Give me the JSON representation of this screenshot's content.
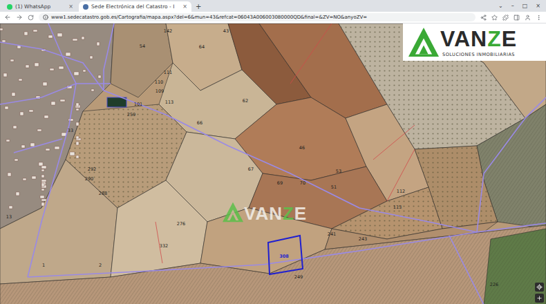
{
  "browser": {
    "tabs": [
      {
        "label": "(1) WhatsApp",
        "selected": false,
        "close": "×",
        "favicon_color": "#25d366"
      },
      {
        "label": "Sede Electrónica del Catastro - I",
        "selected": true,
        "close": "×",
        "favicon_color": "#4a6fa5"
      }
    ],
    "new_tab": "+",
    "window_controls": [
      "⌄",
      "–",
      "□",
      "×"
    ],
    "address": "www1.sedecatastro.gob.es/Cartografia/mapa.aspx?del=6&mun=43&refcat=06043A006003080000QD&final=&ZV=NO&anyoZV="
  },
  "logo": {
    "letters": [
      {
        "text": "VAN",
        "color": "#2b2b2b"
      },
      {
        "text": "Z",
        "color": "#3aa935"
      },
      {
        "text": "E",
        "color": "#2b2b2b"
      }
    ],
    "tagline": "SOLUCIONES INMOBILIARIAS"
  },
  "watermark": {
    "letters": [
      {
        "text": "VAN",
        "color": "#f2efe9"
      },
      {
        "text": "Z",
        "color": "#5cc04a"
      },
      {
        "text": "E",
        "color": "#f2efe9"
      }
    ]
  },
  "parcels": [
    {
      "label": "142",
      "selected": false
    },
    {
      "label": "43",
      "selected": false
    },
    {
      "label": "64",
      "selected": false
    },
    {
      "label": "54",
      "selected": false
    },
    {
      "label": "111",
      "selected": false
    },
    {
      "label": "110",
      "selected": false
    },
    {
      "label": "109",
      "selected": false
    },
    {
      "label": "113",
      "selected": false
    },
    {
      "label": "101",
      "selected": false
    },
    {
      "label": "259",
      "selected": false
    },
    {
      "label": "66",
      "selected": false
    },
    {
      "label": "62",
      "selected": false
    },
    {
      "label": "46",
      "selected": false
    },
    {
      "label": "67",
      "selected": false
    },
    {
      "label": "69",
      "selected": false
    },
    {
      "label": "70",
      "selected": false
    },
    {
      "label": "53",
      "selected": false
    },
    {
      "label": "51",
      "selected": false
    },
    {
      "label": "112",
      "selected": false
    },
    {
      "label": "113",
      "selected": false
    },
    {
      "label": "13",
      "selected": false
    },
    {
      "label": "1",
      "selected": false
    },
    {
      "label": "2",
      "selected": false
    },
    {
      "label": "276",
      "selected": false
    },
    {
      "label": "332",
      "selected": false
    },
    {
      "label": "308",
      "selected": true
    },
    {
      "label": "249",
      "selected": false
    },
    {
      "label": "241",
      "selected": false
    },
    {
      "label": "243",
      "selected": false
    },
    {
      "label": "226",
      "selected": false
    },
    {
      "label": "290",
      "selected": false
    },
    {
      "label": "288",
      "selected": false
    },
    {
      "label": "292",
      "selected": false
    },
    {
      "label": "33",
      "selected": false
    }
  ]
}
